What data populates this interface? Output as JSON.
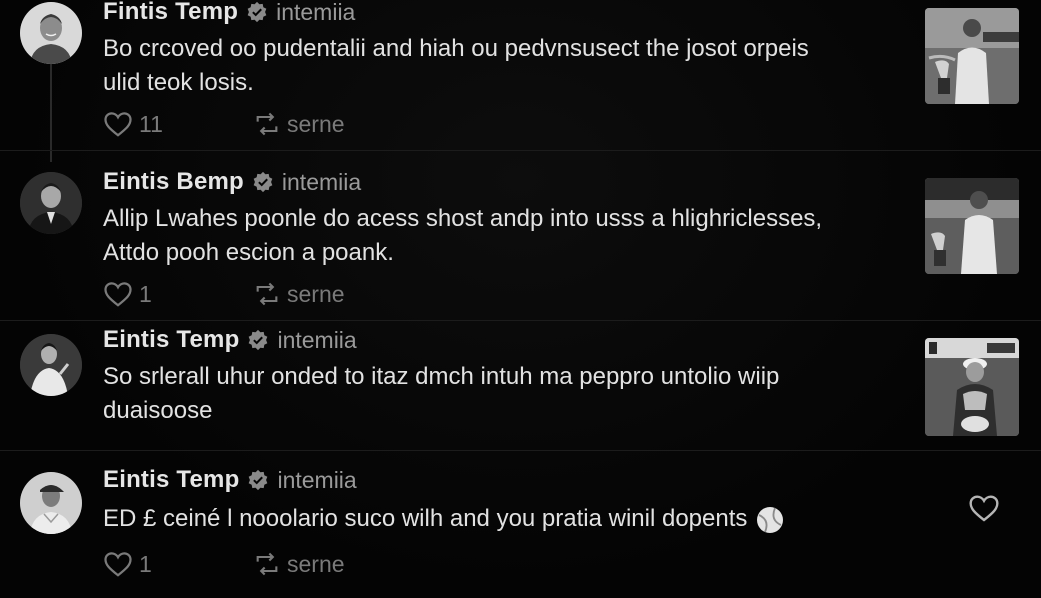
{
  "posts": [
    {
      "author": "Fintis Temp",
      "handle": "intemiia",
      "text_lines": [
        "Bo crcoved oo pudentalii and hiah ou pedvnsusect the josot orpeis",
        "ulid teok losis."
      ],
      "likes": "11",
      "share_label": "serne",
      "avatar_icon": "avatar-man-smiling",
      "thumbnail_icon": "tennis-player-trophy-photo"
    },
    {
      "author": "Eintis Bemp",
      "handle": "intemiia",
      "text_lines": [
        "Allip Lwahes poonle do acess shost andp into usss a hlighriclesses,",
        "Attdo pooh escion a poank."
      ],
      "likes": "1",
      "share_label": "serne",
      "avatar_icon": "avatar-man-suit",
      "thumbnail_icon": "tennis-player-trophy-photo"
    },
    {
      "author": "Eintis Temp",
      "handle": "intemiia",
      "text_lines": [
        "So srlerall uhur onded to itaz dmch intuh ma peppro untolio wiip",
        "duaisoose"
      ],
      "avatar_icon": "avatar-tennis-player",
      "thumbnail_icon": "tennis-player-cap-photo"
    },
    {
      "author": "Eintis Temp",
      "handle": "intemiia",
      "text_lines": [
        "ED £ ceiné l nooolario suco wilh and you pratia winil dopents"
      ],
      "emoji_icon": "tennis-ball-icon",
      "likes": "1",
      "share_label": "serne",
      "avatar_icon": "avatar-player-cap",
      "side_icon": "heart-outline-icon"
    }
  ],
  "colors": {
    "background": "#050505",
    "text": "#e2e2e2",
    "muted": "#9a9a9a",
    "actions": "#7a7a7a"
  }
}
